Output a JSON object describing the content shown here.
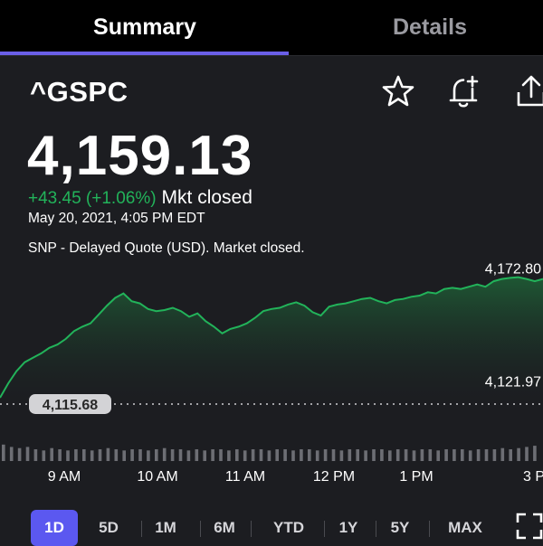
{
  "tabs": {
    "summary": "Summary",
    "details": "Details"
  },
  "quote": {
    "symbol": "^GSPC",
    "price": "4,159.13",
    "change": "+43.45 (+1.06%)",
    "market_status": "Mkt closed",
    "date": "May 20, 2021, 4:05 PM EDT",
    "note": "SNP - Delayed Quote (USD). Market closed."
  },
  "icons": {
    "watchlist": "star-icon",
    "alert": "bell-plus-icon",
    "share": "share-icon",
    "fullscreen": "expand-icon"
  },
  "colors": {
    "accent": "#5b58f0",
    "up": "#22b35a",
    "background": "#1c1d21"
  },
  "chart_data": {
    "type": "area",
    "x_unit": "time of day",
    "x": [
      "9:30",
      "9:35",
      "9:40",
      "9:45",
      "9:50",
      "9:55",
      "10:00",
      "10:05",
      "10:10",
      "10:15",
      "10:20",
      "10:25",
      "10:30",
      "10:35",
      "10:40",
      "10:45",
      "10:50",
      "10:55",
      "11:00",
      "11:05",
      "11:10",
      "11:15",
      "11:20",
      "11:25",
      "11:30",
      "11:35",
      "11:40",
      "11:45",
      "11:50",
      "11:55",
      "12:00",
      "12:05",
      "12:10",
      "12:15",
      "12:20",
      "12:25",
      "12:30",
      "12:35",
      "12:40",
      "12:45",
      "12:50",
      "12:55",
      "13:00",
      "13:05",
      "13:10",
      "13:15",
      "13:20",
      "13:25",
      "13:30",
      "13:35",
      "13:40",
      "13:45",
      "13:50",
      "13:55",
      "14:00",
      "14:05",
      "14:10",
      "14:15",
      "14:20",
      "14:25",
      "14:30",
      "14:35",
      "14:40",
      "14:45",
      "14:50",
      "14:55",
      "15:00"
    ],
    "values": [
      4118.5,
      4125.0,
      4130.5,
      4134.5,
      4136.5,
      4138.5,
      4141.0,
      4142.5,
      4145.0,
      4148.5,
      4150.5,
      4152.0,
      4156.0,
      4160.0,
      4163.5,
      4165.5,
      4162.0,
      4161.0,
      4158.5,
      4157.5,
      4158.0,
      4159.0,
      4157.5,
      4155.0,
      4156.5,
      4153.0,
      4150.5,
      4147.5,
      4149.5,
      4150.5,
      4152.0,
      4154.5,
      4157.5,
      4158.5,
      4159.0,
      4160.5,
      4161.5,
      4160.0,
      4157.0,
      4155.5,
      4159.5,
      4160.5,
      4161.0,
      4162.0,
      4163.0,
      4163.5,
      4162.0,
      4161.0,
      4162.5,
      4163.0,
      4164.0,
      4164.5,
      4166.0,
      4165.5,
      4167.5,
      4168.0,
      4167.5,
      4168.5,
      4169.5,
      4168.5,
      4171.0,
      4172.0,
      4172.5,
      4172.8,
      4172.0,
      4171.0,
      4172.0
    ],
    "high_label": "4,172.80",
    "low_label": "4,121.97",
    "previous_close_label": "4,115.68",
    "high": 4172.8,
    "low": 4121.97,
    "previous_close": 4115.68,
    "x_ticks": [
      "9 AM",
      "10 AM",
      "11 AM",
      "12 PM",
      "1 PM",
      "3 P"
    ],
    "volume": [
      0.7,
      0.6,
      0.55,
      0.6,
      0.5,
      0.45,
      0.55,
      0.5,
      0.45,
      0.5,
      0.5,
      0.45,
      0.5,
      0.55,
      0.5,
      0.45,
      0.5,
      0.5,
      0.45,
      0.5,
      0.55,
      0.5,
      0.5,
      0.45,
      0.5,
      0.45,
      0.5,
      0.5,
      0.45,
      0.5,
      0.45,
      0.5,
      0.5,
      0.45,
      0.5,
      0.5,
      0.45,
      0.5,
      0.5,
      0.45,
      0.5,
      0.5,
      0.45,
      0.5,
      0.5,
      0.45,
      0.5,
      0.5,
      0.45,
      0.5,
      0.5,
      0.45,
      0.5,
      0.5,
      0.45,
      0.5,
      0.5,
      0.5,
      0.45,
      0.5,
      0.5,
      0.5,
      0.55,
      0.5,
      0.55,
      0.6,
      0.65
    ]
  },
  "ranges": [
    "1D",
    "5D",
    "1M",
    "6M",
    "YTD",
    "1Y",
    "5Y",
    "MAX"
  ],
  "active_range": "1D"
}
